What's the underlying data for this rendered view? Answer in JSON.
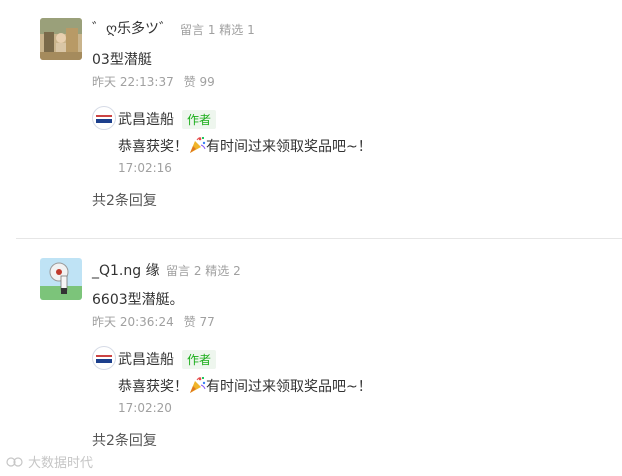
{
  "comments": [
    {
      "nickname": "゛ღ乐多ツ゛",
      "stats": "留言 1 精选 1",
      "content": "03型潜艇",
      "time": "昨天 22:13:37",
      "likes": "赞 99",
      "reply": {
        "name": "武昌造船",
        "badge": "作者",
        "text_before": "恭喜获奖！",
        "emoji": "party-popper-icon",
        "text_after": "有时间过来领取奖品吧~！",
        "time": "17:02:16"
      },
      "more": "共2条回复"
    },
    {
      "nickname": "_Q1.ng 缘",
      "stats": "留言 2 精选 2",
      "content": "6603型潜艇。",
      "time": "昨天 20:36:24",
      "likes": "赞 77",
      "reply": {
        "name": "武昌造船",
        "badge": "作者",
        "text_before": "恭喜获奖！",
        "emoji": "party-popper-icon",
        "text_after": "有时间过来领取奖品吧~！",
        "time": "17:02:20"
      },
      "more": "共2条回复"
    }
  ],
  "watermark": "大数据时代"
}
